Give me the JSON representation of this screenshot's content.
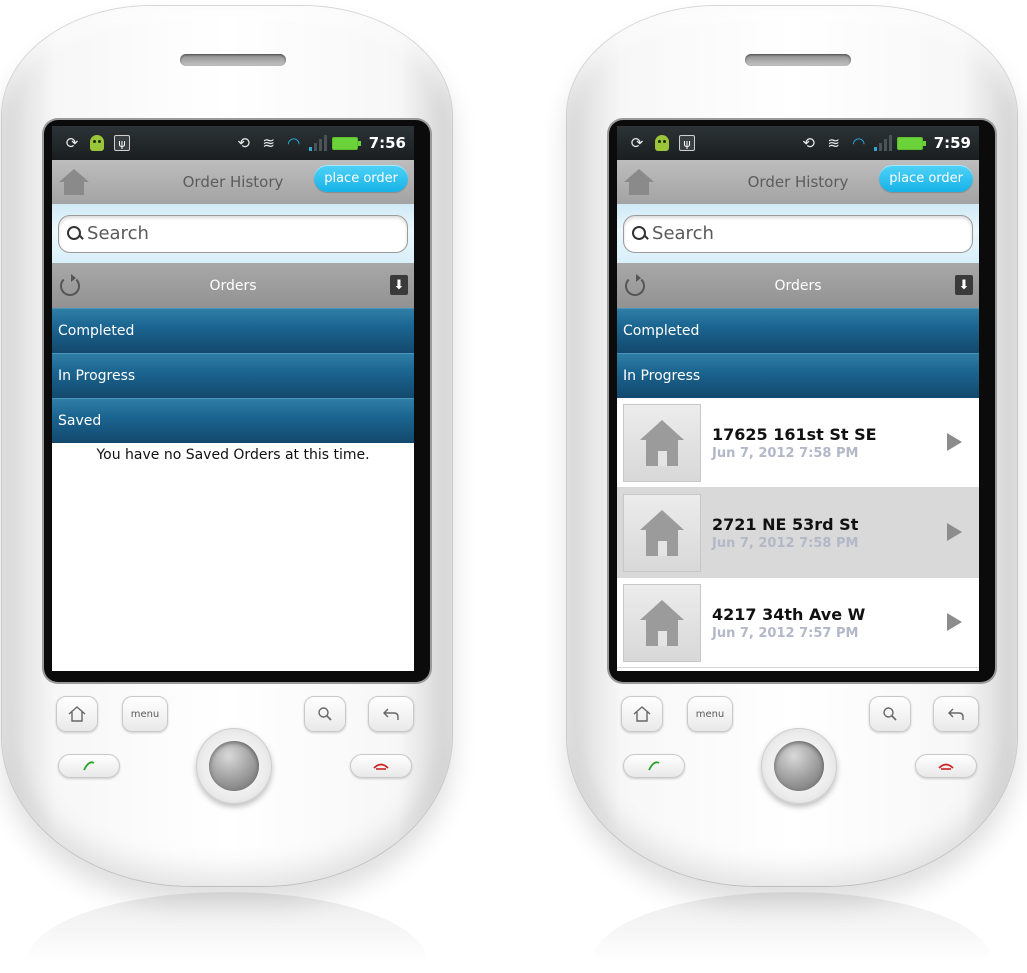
{
  "phones": [
    {
      "status": {
        "time": "7:56"
      },
      "header": {
        "title": "Order History",
        "place_order_label": "place order"
      },
      "search": {
        "placeholder": "Search"
      },
      "orders_bar": {
        "label": "Orders"
      },
      "sections": [
        {
          "label": "Completed"
        },
        {
          "label": "In Progress"
        },
        {
          "label": "Saved"
        }
      ],
      "empty_message": "You have no Saved Orders at this time."
    },
    {
      "status": {
        "time": "7:59"
      },
      "header": {
        "title": "Order History",
        "place_order_label": "place order"
      },
      "search": {
        "placeholder": "Search"
      },
      "orders_bar": {
        "label": "Orders"
      },
      "sections": [
        {
          "label": "Completed"
        },
        {
          "label": "In Progress"
        }
      ],
      "orders": [
        {
          "address": "17625 161st St SE",
          "date": "Jun 7, 2012 7:58 PM",
          "selected": false
        },
        {
          "address": "2721 NE 53rd St",
          "date": "Jun 7, 2012 7:58 PM",
          "selected": true
        },
        {
          "address": "4217 34th Ave W",
          "date": "Jun 7, 2012 7:57 PM",
          "selected": false
        }
      ]
    }
  ],
  "hardware": {
    "menu_label": "menu"
  },
  "icons": [
    "home-icon",
    "refresh-icon",
    "download-icon",
    "search-icon",
    "house-icon",
    "chevron-right-icon",
    "sync-icon",
    "android-icon",
    "usb-icon",
    "vibrate-icon",
    "wifi-icon",
    "signal-icon",
    "battery-icon",
    "back-icon",
    "call-icon",
    "end-call-icon"
  ],
  "colors": {
    "accent": "#17b2e8",
    "section_blue": "#1b6591",
    "date_gray": "#b3b8c8"
  }
}
